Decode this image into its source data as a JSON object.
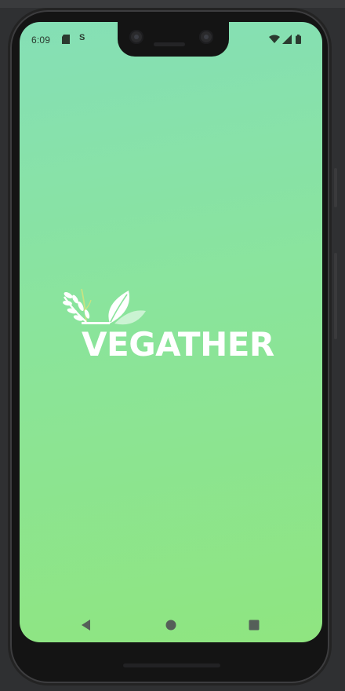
{
  "status_bar": {
    "time": "6:09",
    "notification_icons": [
      "sd-card-icon",
      "s-app-icon"
    ],
    "s_glyph": "S",
    "system_icons": [
      "wifi-icon",
      "cell-signal-icon",
      "battery-icon"
    ]
  },
  "splash": {
    "brand_name": "VEGATHER",
    "logo_icon": "leaves-logo-icon",
    "background_gradient": [
      "#85dfb6",
      "#8fe580"
    ]
  },
  "nav_bar": {
    "buttons": [
      "back",
      "home",
      "recents"
    ]
  },
  "colors": {
    "brand_text": "#ffffff",
    "device_frame": "#141414"
  }
}
